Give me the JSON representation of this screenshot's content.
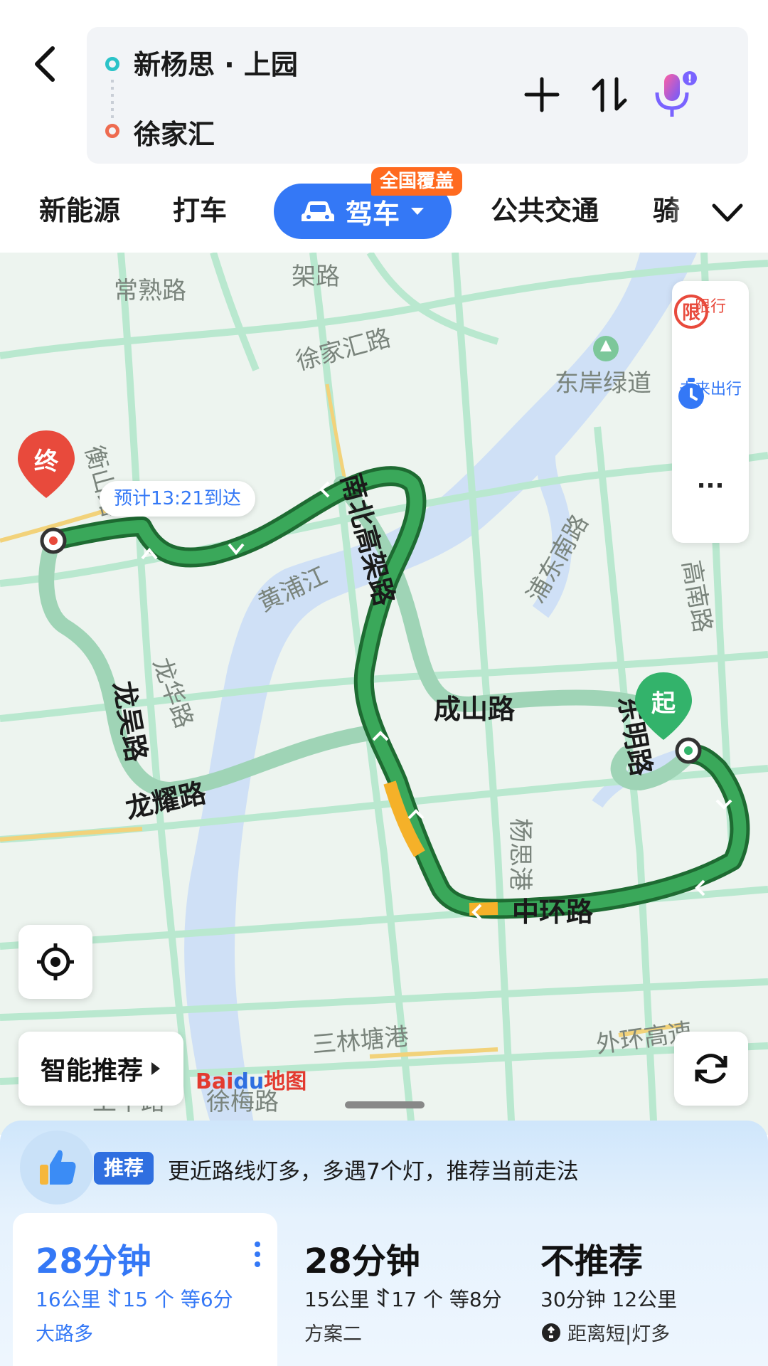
{
  "header": {
    "start": "新杨思 · 上园",
    "end": "徐家汇",
    "icons": [
      "back-icon",
      "add-icon",
      "swap-icon",
      "voice-icon"
    ]
  },
  "tabs": {
    "items": [
      "新能源",
      "打车",
      "驾车",
      "公共交通",
      "骑"
    ],
    "active": "驾车",
    "badge": "全国覆盖"
  },
  "map": {
    "road_labels": [
      "常熟路",
      "架路",
      "徐家汇路",
      "东岸绿道",
      "南北高架路",
      "黄浦江",
      "浦东南路",
      "龙华路",
      "龙吴路",
      "龙耀路",
      "成山路",
      "东明路",
      "杨思港",
      "中环路",
      "三林塘港",
      "外环高速",
      "高南路",
      "衡山路",
      "上中路",
      "徐梅路"
    ],
    "eta_label": "预计13:21到达",
    "start_marker": "起",
    "end_marker": "终",
    "side_panel": {
      "restrict_icon": "限",
      "restrict": "限行",
      "future": "未来出行",
      "more": "···"
    },
    "smart_button": "智能推荐",
    "logo": {
      "part1": "Bai",
      "part2": "du",
      "part3": "地图"
    },
    "colors": {
      "route_green": "#3aa85a",
      "route_alt": "#9fd4b6",
      "traffic_amber": "#f5b129",
      "water": "#cfe0f6",
      "road": "#b9e8cf"
    }
  },
  "recommend": {
    "tag": "推荐",
    "text": "更近路线灯多，多遇7个灯，推荐当前走法"
  },
  "routes": [
    {
      "time": "28分钟",
      "distance": "16公里",
      "lights": "15 个",
      "wait": "等6分",
      "note": "大路多",
      "selected": true
    },
    {
      "time": "28分钟",
      "distance": "15公里",
      "lights": "17 个",
      "wait": "等8分",
      "note": "方案二",
      "selected": false
    },
    {
      "time": "不推荐",
      "detail": "30分钟 12公里",
      "note": "距离短|灯多",
      "selected": false
    }
  ]
}
